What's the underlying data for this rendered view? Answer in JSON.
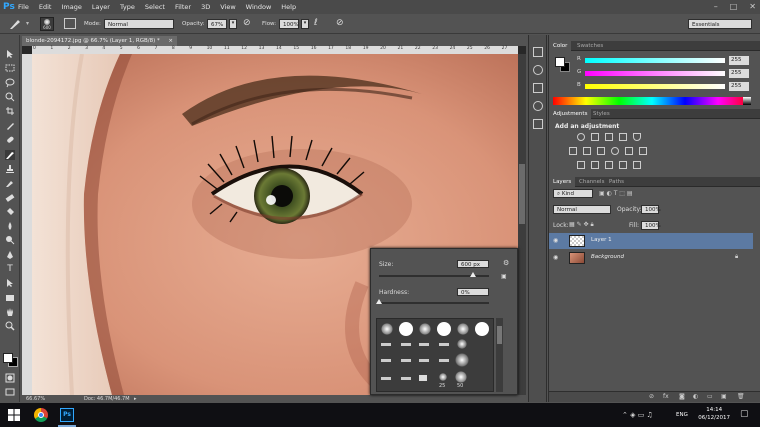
{
  "app": {
    "logo": "Ps",
    "menu": [
      "File",
      "Edit",
      "Image",
      "Layer",
      "Type",
      "Select",
      "Filter",
      "3D",
      "View",
      "Window",
      "Help"
    ],
    "workspace": "Essentials"
  },
  "options": {
    "brush_size": "600",
    "mode_label": "Mode:",
    "mode_value": "Normal",
    "opacity_label": "Opacity:",
    "opacity_value": "67%",
    "flow_label": "Flow:",
    "flow_value": "100%"
  },
  "document": {
    "tab_title": "blonde-2094172.jpg @ 66.7% (Layer 1, RGB/8) *",
    "zoom": "66.67%",
    "doc_info": "Doc: 46.7M/46.7M",
    "ruler_marks": [
      "0",
      "1",
      "2",
      "3",
      "4",
      "5",
      "6",
      "7",
      "8",
      "9",
      "10",
      "11",
      "12",
      "13",
      "14",
      "15",
      "16",
      "17",
      "18",
      "19",
      "20",
      "21",
      "22",
      "23",
      "24",
      "25",
      "26",
      "27"
    ]
  },
  "brush_popup": {
    "size_label": "Size:",
    "size_value": "600 px",
    "hardness_label": "Hardness:",
    "hardness_value": "0%",
    "size_fraction": 0.85,
    "hardness_fraction": 0.0,
    "tip_sizes": [
      "25",
      "50"
    ]
  },
  "color_panel": {
    "tabs": [
      "Color",
      "Swatches"
    ],
    "channels": [
      {
        "label": "R",
        "value": "255",
        "color": "#ff0000"
      },
      {
        "label": "G",
        "value": "255",
        "color": "#00ff00"
      },
      {
        "label": "B",
        "value": "255",
        "color": "#0000ff"
      }
    ]
  },
  "adjustments_panel": {
    "tabs": [
      "Adjustments",
      "Styles"
    ],
    "heading": "Add an adjustment"
  },
  "layers_panel": {
    "tabs": [
      "Layers",
      "Channels",
      "Paths"
    ],
    "kind_label": "Kind",
    "blend_mode": "Normal",
    "opacity_label": "Opacity:",
    "opacity_value": "100%",
    "lock_label": "Lock:",
    "fill_label": "Fill:",
    "fill_value": "100%",
    "layers": [
      {
        "name": "Layer 1",
        "selected": true
      },
      {
        "name": "Background",
        "selected": false
      }
    ]
  },
  "taskbar": {
    "language": "ENG",
    "time": "14:14",
    "date": "06/12/2017"
  },
  "colors": {
    "accent": "#31a8ff",
    "selection": "#5c7aa3",
    "panel_bg": "#535353"
  }
}
